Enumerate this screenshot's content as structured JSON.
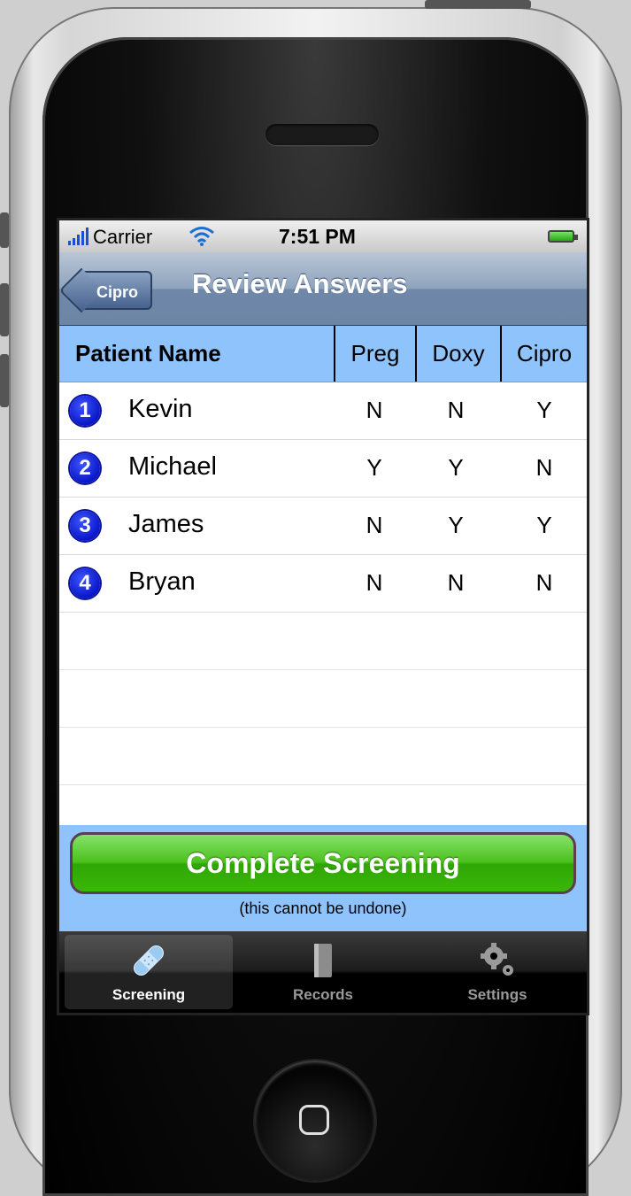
{
  "status_bar": {
    "carrier": "Carrier",
    "time": "7:51 PM"
  },
  "nav_bar": {
    "back_label": "Cipro",
    "title": "Review Answers"
  },
  "table": {
    "headers": {
      "name": "Patient Name",
      "preg": "Preg",
      "doxy": "Doxy",
      "cipro": "Cipro"
    },
    "rows": [
      {
        "num": "1",
        "name": "Kevin",
        "preg": "N",
        "doxy": "N",
        "cipro": "Y"
      },
      {
        "num": "2",
        "name": "Michael",
        "preg": "Y",
        "doxy": "Y",
        "cipro": "N"
      },
      {
        "num": "3",
        "name": "James",
        "preg": "N",
        "doxy": "Y",
        "cipro": "Y"
      },
      {
        "num": "4",
        "name": "Bryan",
        "preg": "N",
        "doxy": "N",
        "cipro": "N"
      }
    ]
  },
  "footer": {
    "button_label": "Complete Screening",
    "note": "(this cannot be undone)"
  },
  "tabs": [
    {
      "label": "Screening",
      "icon": "bandage-icon",
      "active": true
    },
    {
      "label": "Records",
      "icon": "book-icon",
      "active": false
    },
    {
      "label": "Settings",
      "icon": "gear-icon",
      "active": false
    }
  ],
  "colors": {
    "header_blue": "#8fc3fb",
    "button_green": "#3bb708",
    "badge_blue": "#0a17c8"
  }
}
